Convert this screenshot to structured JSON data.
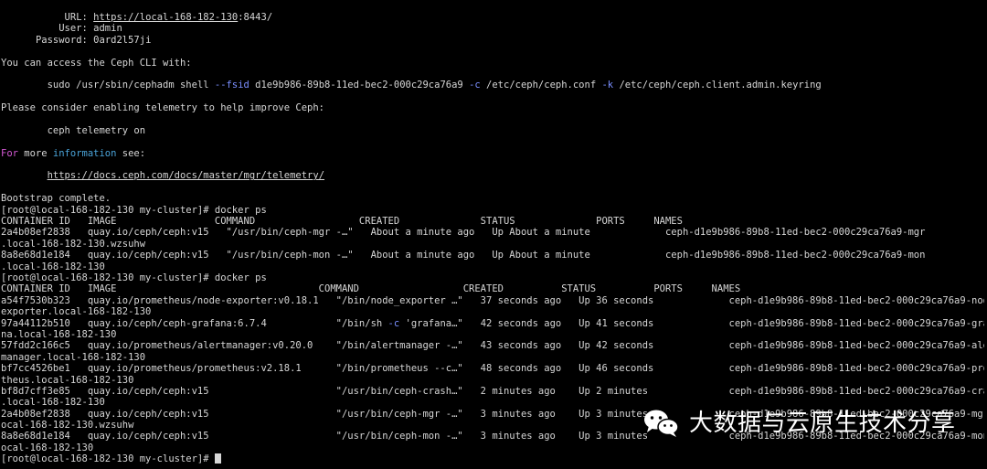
{
  "dashboard": {
    "url_label": "URL:",
    "url_link": "https://local-168-182-130",
    "url_port": ":8443/",
    "user_label": "User:",
    "user_value": "admin",
    "password_label": "Password:",
    "password_value": "0ard2l57ji"
  },
  "cli": {
    "intro": "You can access the Ceph CLI with:",
    "cmd_p1": "sudo /usr/sbin/cephadm shell ",
    "fsid_flag": "--fsid",
    "fsid_value": " d1e9b986-89b8-11ed-bec2-000c29ca76a9 ",
    "c_flag": "-c",
    "c_value": " /etc/ceph/ceph.conf ",
    "k_flag": "-k",
    "k_value": " /etc/ceph/ceph.client.admin.keyring"
  },
  "telemetry": {
    "intro": "Please consider enabling telemetry to help improve Ceph:",
    "command": "ceph telemetry on",
    "for_word": "For",
    "more_word": " more ",
    "info_word": "information",
    "see_word": " see:",
    "link": "https://docs.ceph.com/docs/master/mgr/telemetry/"
  },
  "bootstrap_done": "Bootstrap complete.",
  "ps1": {
    "prompt": "[root@local-168-182-130 my-cluster]# docker ps",
    "header": "CONTAINER ID   IMAGE                 COMMAND                  CREATED              STATUS              PORTS     NAMES",
    "rows": [
      "2a4b08ef2838   quay.io/ceph/ceph:v15   \"/usr/bin/ceph-mgr -…\"   About a minute ago   Up About a minute             ceph-d1e9b986-89b8-11ed-bec2-000c29ca76a9-mgr",
      ".local-168-182-130.wzsuhw",
      "8a8e68d1e184   quay.io/ceph/ceph:v15   \"/usr/bin/ceph-mon -…\"   About a minute ago   Up About a minute             ceph-d1e9b986-89b8-11ed-bec2-000c29ca76a9-mon",
      ".local-168-182-130"
    ]
  },
  "ps2": {
    "prompt": "[root@local-168-182-130 my-cluster]# docker ps",
    "header": "CONTAINER ID   IMAGE                                   COMMAND                  CREATED          STATUS          PORTS     NAMES",
    "r1": "a54f7530b323   quay.io/prometheus/node-exporter:v0.18.1   \"/bin/node_exporter …\"   37 seconds ago   Up 36 seconds             ceph-d1e9b986-89b8-11ed-bec2-000c29ca76a9-node-",
    "r1w": "exporter.local-168-182-130",
    "r2a": "97a44112b510   quay.io/ceph/ceph-grafana:6.7.4            \"/bin/sh ",
    "r2flag": "-c",
    "r2b": " 'grafana…\"   42 seconds ago   Up 41 seconds             ceph-d1e9b986-89b8-11ed-bec2-000c29ca76a9-grafa",
    "r2w": "na.local-168-182-130",
    "r3": "57fdd2c166c5   quay.io/prometheus/alertmanager:v0.20.0    \"/bin/alertmanager -…\"   43 seconds ago   Up 42 seconds             ceph-d1e9b986-89b8-11ed-bec2-000c29ca76a9-alert",
    "r3w": "manager.local-168-182-130",
    "r4": "bf7cc4526be1   quay.io/prometheus/prometheus:v2.18.1      \"/bin/prometheus --c…\"   48 seconds ago   Up 46 seconds             ceph-d1e9b986-89b8-11ed-bec2-000c29ca76a9-prome",
    "r4w": "theus.local-168-182-130",
    "r5": "bf8d7cff3e85   quay.io/ceph/ceph:v15                      \"/usr/bin/ceph-crash…\"   2 minutes ago    Up 2 minutes              ceph-d1e9b986-89b8-11ed-bec2-000c29ca76a9-crash",
    "r5w": ".local-168-182-130",
    "r6": "2a4b08ef2838   quay.io/ceph/ceph:v15                      \"/usr/bin/ceph-mgr -…\"   3 minutes ago    Up 3 minutes              ceph-d1e9b986-89b8-11ed-bec2-000c29ca76a9-mgr.l",
    "r6w": "ocal-168-182-130.wzsuhw",
    "r7": "8a8e68d1e184   quay.io/ceph/ceph:v15                      \"/usr/bin/ceph-mon -…\"   3 minutes ago    Up 3 minutes              ceph-d1e9b986-89b8-11ed-bec2-000c29ca76a9-mon.l",
    "r7w": "ocal-168-182-130"
  },
  "final_prompt": "[root@local-168-182-130 my-cluster]# ",
  "watermark": {
    "icon": "wechat-icon",
    "text": "大数据与云原生技术分享"
  }
}
